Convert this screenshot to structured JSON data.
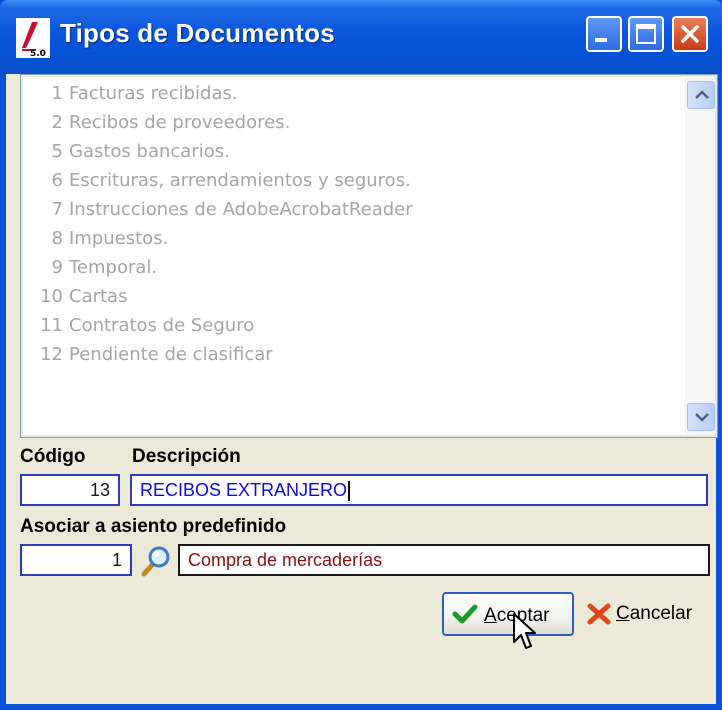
{
  "window": {
    "title": "Tipos de Documentos",
    "app_icon_label": "5.0"
  },
  "document_types": [
    {
      "number": "1",
      "name": "Facturas recibidas."
    },
    {
      "number": "2",
      "name": "Recibos de proveedores."
    },
    {
      "number": "5",
      "name": "Gastos bancarios."
    },
    {
      "number": "6",
      "name": "Escrituras, arrendamientos y seguros."
    },
    {
      "number": "7",
      "name": "Instrucciones de AdobeAcrobatReader"
    },
    {
      "number": "8",
      "name": "Impuestos."
    },
    {
      "number": "9",
      "name": "Temporal."
    },
    {
      "number": "10",
      "name": "Cartas"
    },
    {
      "number": "11",
      "name": "Contratos de Seguro"
    },
    {
      "number": "12",
      "name": "Pendiente de clasificar"
    }
  ],
  "form": {
    "codigo_label": "Código",
    "codigo_value": "13",
    "descripcion_label": "Descripción",
    "descripcion_value": "RECIBOS EXTRANJERO",
    "asiento_label": "Asociar a asiento predefinido",
    "asiento_number": "1",
    "asiento_name": "Compra de mercaderías"
  },
  "buttons": {
    "accept_label": "Aceptar",
    "cancel_label": "Cancelar"
  },
  "colors": {
    "titlebar": "#0a55dd",
    "dialog_bg": "#ece9d8",
    "list_text": "#a5a5a5",
    "description_text": "#0a0ae8",
    "asiento_text": "#8a1010"
  }
}
